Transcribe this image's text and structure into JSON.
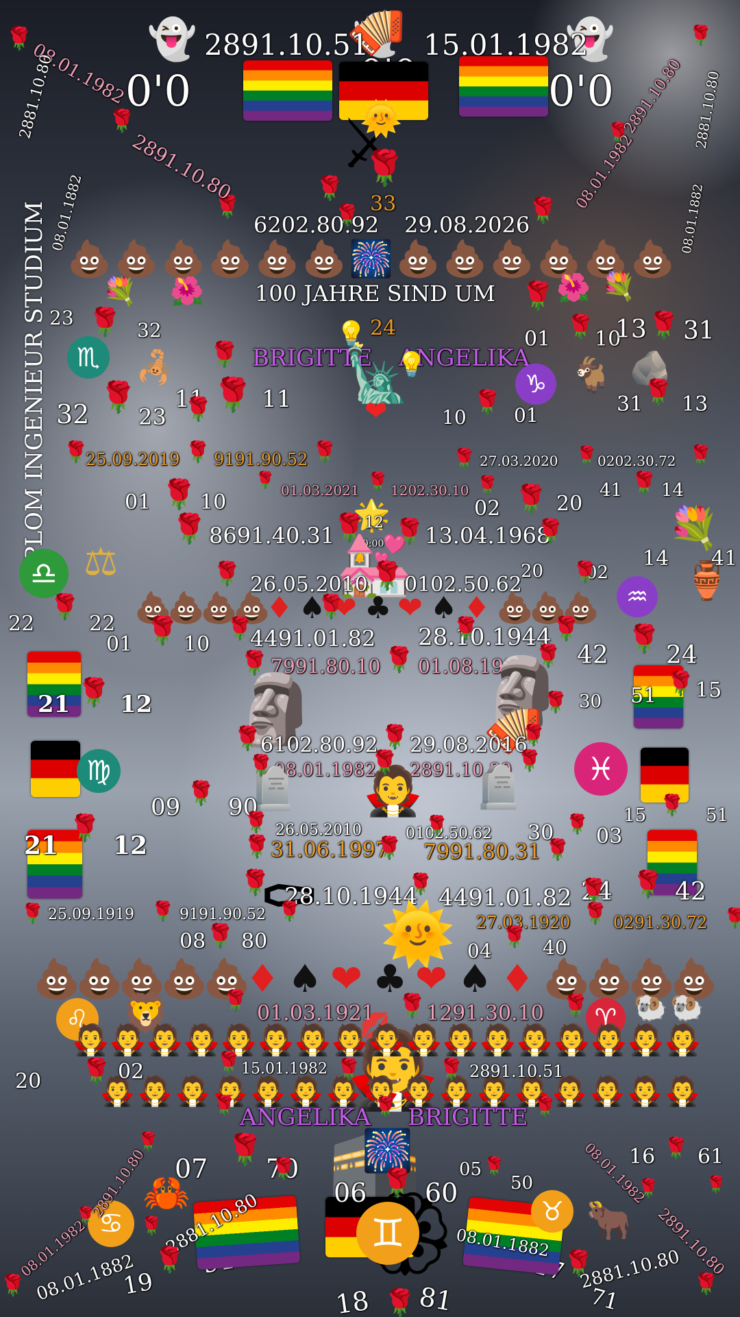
{
  "top": {
    "date_mirror_left": "2891.10.51",
    "date_right": "15.01.1982",
    "label_left": "0'0",
    "label_center": "0'0",
    "label_right": "0'0"
  },
  "side_texts": {
    "vertical_label": "DIPLOM INGENIEUR STUDIUM",
    "tl_1": "08.01.1982",
    "tl_2": "2891.10.80",
    "tl_3": "2881.10.80",
    "tl_4": "08.01.1882",
    "tr_1": "08.01.1982",
    "tr_2": "2891.10.80",
    "tr_3": "2881.10.80",
    "tr_4": "08.01.1882"
  },
  "row_2026": {
    "left": "6202.80.92",
    "num": "33",
    "right": "29.08.2026"
  },
  "banner": {
    "centenary": "100 JAHRE SIND UM",
    "num": "24"
  },
  "names_top": {
    "left": "BRIGITTE",
    "right": "ANGELIKA"
  },
  "numbers_upper": {
    "n23": "23",
    "n32": "32",
    "n01": "01",
    "n10": "10",
    "n13": "13",
    "n31": "31",
    "n32b": "32",
    "n23b": "23",
    "n11a": "11",
    "n11b": "11",
    "n10b": "10",
    "n01b": "01",
    "n31b": "31",
    "n13b": "13"
  },
  "row_2019_2020": {
    "left": "25.09.2019",
    "left_mirror": "9191.90.52",
    "right": "27.03.2020",
    "right_mirror": "0202.30.72"
  },
  "row_2021": {
    "left": "01.03.2021",
    "right_mirror": "1202.30.10",
    "n01": "01",
    "n10": "10",
    "n02": "02",
    "n20": "20",
    "n41": "41",
    "n14": "14"
  },
  "row_1968": {
    "left_mirror": "8691.40.31",
    "time": "00:00",
    "num": "12",
    "right": "13.04.1968"
  },
  "row_2010": {
    "left": "26.05.2010",
    "right_mirror": "0102.50.62",
    "n20": "20",
    "n02": "02",
    "n14": "14",
    "n41": "41",
    "n22a": "22",
    "n22b": "22"
  },
  "row_1944": {
    "left_mirror": "4491.01.82",
    "right": "28.10.1944",
    "left_pink": "7991.80.10",
    "right_pink": "01.08.1997",
    "n01": "01",
    "n10": "10",
    "n42": "42",
    "n24": "24"
  },
  "numbers_mid": {
    "n21": "21",
    "n12": "12",
    "n03": "03",
    "n30": "30",
    "n51": "51",
    "n15": "15"
  },
  "row_2016": {
    "left_mirror": "6102.80.92",
    "right": "29.08.2016",
    "left_pink": "08.01.1982",
    "right_pink": "2891.10.80"
  },
  "numbers_lower": {
    "n09": "09",
    "n90": "90",
    "n15": "15",
    "n51": "51",
    "n21": "21",
    "n12": "12",
    "n30": "30",
    "n03": "03",
    "n24": "24",
    "n42": "42"
  },
  "row_2010b": {
    "left": "26.05.2010",
    "right_mirror": "0102.50.62",
    "left_orange": "31.06.1997",
    "right_orange": "7991.80.31"
  },
  "row_1944b": {
    "left": "28.10.1944",
    "right_mirror": "4491.01.82",
    "left_small": "25.09.1919",
    "left_small_mirror": "9191.90.52",
    "right_orange": "27.03.1920",
    "right_orange_mirror": "0291.30.72",
    "n08": "08",
    "n80": "80",
    "n04": "04",
    "n40": "40"
  },
  "row_1921": {
    "left": "01.03.1921",
    "right_mirror": "1291.30.10"
  },
  "row_1982": {
    "left": "15.01.1982",
    "right_mirror": "2891.10.51",
    "n20": "20",
    "n02": "02"
  },
  "names_bottom": {
    "left": "ANGELIKA",
    "right": "BRIGITTE"
  },
  "bottom": {
    "n07": "07",
    "n70": "70",
    "n06": "06",
    "n60": "60",
    "n05": "05",
    "n50": "50",
    "n16": "16",
    "n61": "61",
    "n91": "91",
    "n19": "19",
    "n18": "18",
    "n81": "81",
    "n17": "17",
    "n71": "71",
    "bl_1": "2891.10.80",
    "bl_2": "08.01.1982",
    "bl_3": "2881.10.80",
    "bl_4": "08.01.1882",
    "br_1": "08.01.1982",
    "br_2": "2891.10.80",
    "br_3": "08.01.1882",
    "br_4": "2881.10.80"
  },
  "icons": {
    "ghost": "👻",
    "rose": "🌹",
    "poo": "💩",
    "fireworks": "🎆",
    "bouquet": "💐",
    "hibiscus": "🌺",
    "scorpion": "🦂",
    "goat": "🐐",
    "rock": "🪨",
    "balance": "⚖",
    "amphora": "🏺",
    "moai": "🗿",
    "accordion": "🪗",
    "headstone": "🪦",
    "coffin": "⚰",
    "vampire": "🧛",
    "sun": "🌞",
    "lion": "🦁",
    "ram": "🐏",
    "crab": "🦀",
    "ox": "🐂",
    "rosette": "🏵",
    "kaaba": "🕋",
    "wedding": "💒",
    "statue": "🗽",
    "heart": "❤",
    "spade": "♠",
    "diamond": "♦",
    "club": "♣",
    "lips": "💋",
    "star": "🌟",
    "sword": "⚔",
    "bulb": "💡",
    "scorpio": "♏",
    "capricorn": "♑",
    "libra": "♎",
    "aquarius": "♒",
    "virgo": "♍",
    "pisces": "♓",
    "leo": "♌",
    "aries": "♈",
    "cancer": "♋",
    "taurus": "♉",
    "gemini": "♊"
  },
  "colors": {
    "pink_text": "#f0a0b8",
    "orange_text": "#e89a2a",
    "violet_text": "#c45be8",
    "zodiac_teal": "#1e8a7a",
    "zodiac_purple": "#8a3ec8",
    "zodiac_green": "#2e9a3a",
    "zodiac_pink": "#d8257a",
    "zodiac_orange": "#f2a01a",
    "zodiac_red": "#d8253a"
  }
}
